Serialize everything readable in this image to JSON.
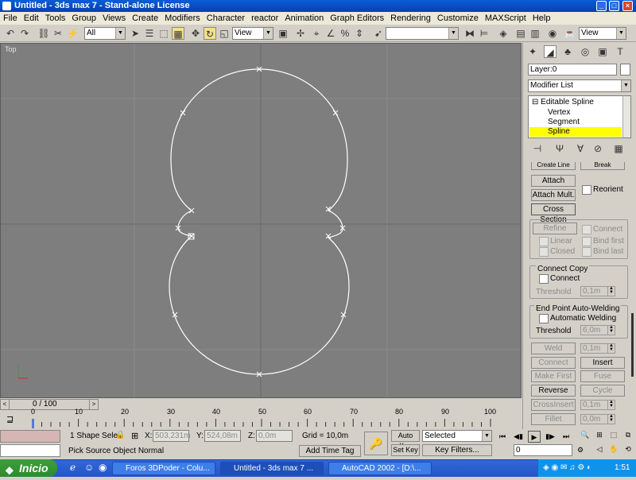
{
  "window": {
    "title": "Untitled - 3ds max 7 - Stand-alone License"
  },
  "menu": [
    "File",
    "Edit",
    "Tools",
    "Group",
    "Views",
    "Create",
    "Modifiers",
    "Character",
    "reactor",
    "Animation",
    "Graph Editors",
    "Rendering",
    "Customize",
    "MAXScript",
    "Help"
  ],
  "toolbar": {
    "selection_filter": "All",
    "ref_coord": "View",
    "named_selection": "",
    "render_view": "View"
  },
  "viewport": {
    "label": "Top"
  },
  "command_panel": {
    "layer": "Layer:0",
    "modifier_list": "Modifier List",
    "stack": [
      "Editable Spline",
      "Vertex",
      "Segment",
      "Spline"
    ],
    "stack_selected": "Spline",
    "top_buttons": [
      "Create Line",
      "Break"
    ],
    "attach": "Attach",
    "reorient": "Reorient",
    "attach_mult": "Attach Mult.",
    "cross_section": "Cross Section",
    "refine": "Refine",
    "connect": "Connect",
    "linear": "Linear",
    "bind_first": "Bind first",
    "closed": "Closed",
    "bind_last": "Bind last",
    "connect_copy": {
      "title": "Connect Copy",
      "connect": "Connect",
      "threshold_label": "Threshold",
      "threshold_value": "0,1m"
    },
    "auto_weld": {
      "title": "End Point Auto-Welding",
      "automatic": "Automatic Welding",
      "threshold_label": "Threshold",
      "threshold_value": "6,0m"
    },
    "weld": "Weld",
    "weld_value": "0,1m",
    "connect_btn": "Connect",
    "insert": "Insert",
    "make_first": "Make First",
    "fuse": "Fuse",
    "reverse": "Reverse",
    "cycle": "Cycle",
    "cross_insert": "CrossInsert",
    "cross_insert_value": "0,1m",
    "fillet": "Fillet",
    "fillet_value": "0,0m"
  },
  "timeline": {
    "position": "0 / 100",
    "ticks": [
      "0",
      "10",
      "20",
      "30",
      "40",
      "50",
      "60",
      "70",
      "80",
      "90",
      "100"
    ]
  },
  "status": {
    "selection": "1 Shape Sele",
    "x_label": "X:",
    "x_value": "503,231m",
    "y_label": "Y:",
    "y_value": "524,08m",
    "z_label": "Z:",
    "z_value": "0,0m",
    "grid": "Grid = 10,0m",
    "auto_key": "Auto Key",
    "set_key": "Set Key",
    "key_mode": "Selected",
    "key_filters": "Key Filters...",
    "frame": "0",
    "prompt": "Pick Source Object Normal",
    "add_time_tag": "Add Time Tag"
  },
  "taskbar": {
    "start": "Inicio",
    "tasks": [
      "Foros 3DPoder - Colu...",
      "Untitled - 3ds max 7 ...",
      "AutoCAD 2002 - [D:\\..."
    ],
    "clock": "1:51"
  },
  "colors": {
    "viewport_bg": "#7e7e7e",
    "spline": "#ffffff",
    "stack_highlight": "#ffff00",
    "title_blue": "#0a5cd6"
  }
}
